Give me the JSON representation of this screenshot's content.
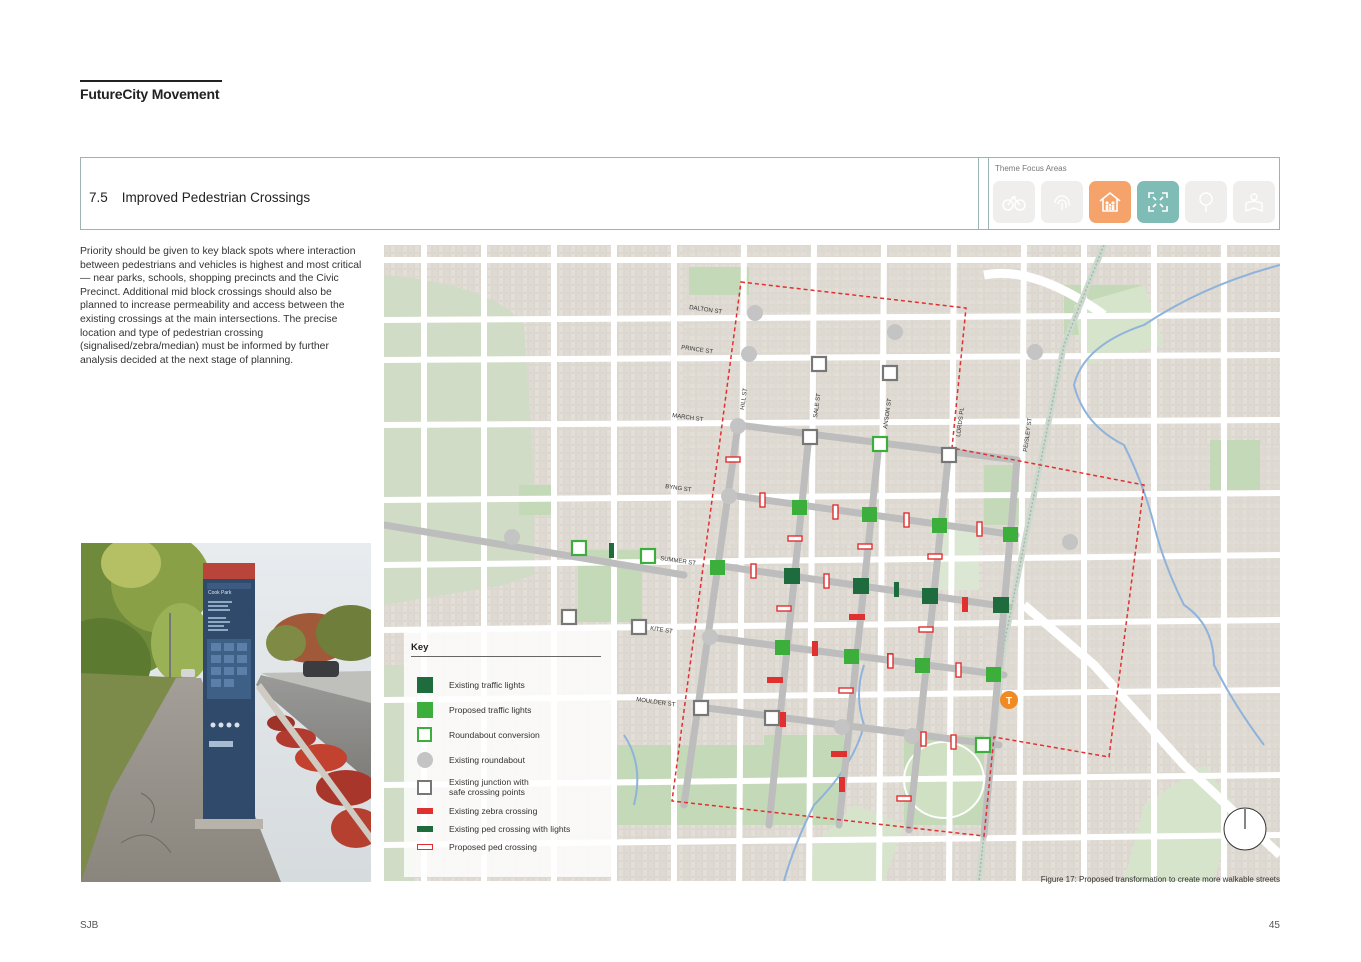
{
  "header": {
    "title": "FutureCity Movement"
  },
  "section": {
    "number": "7.5",
    "title": "Improved Pedestrian Crossings",
    "theme_label": "Theme Focus Areas",
    "themes": [
      {
        "icon": "bike-icon",
        "active": false
      },
      {
        "icon": "fingerprint-icon",
        "active": false
      },
      {
        "icon": "family-house-icon",
        "active": true,
        "color": "#f5a36b"
      },
      {
        "icon": "expand-icon",
        "active": true,
        "color": "#7fbcb5"
      },
      {
        "icon": "tree-icon",
        "active": false
      },
      {
        "icon": "reading-person-icon",
        "active": false
      }
    ]
  },
  "intro": "Priority should be given to key black spots where interaction between pedestrians and vehicles is highest and most critical — near parks, schools, shopping precincts and the Civic Precinct. Additional mid block crossings should also be planned to increase permeability and access between the existing crossings at the main intersections. The precise location and type of pedestrian crossing (signalised/zebra/median) must be informed by further analysis decided at the next stage of planning.",
  "photo": {
    "sign_title": "Cook Park"
  },
  "map": {
    "street_labels": [
      "DALTON ST",
      "PRINCE ST",
      "MARCH ST",
      "BYNG ST",
      "SUMMER ST",
      "KITE ST",
      "MOULDER ST",
      "HILL ST",
      "SALE ST",
      "ANSON ST",
      "LORDS PL",
      "PEISLEY ST"
    ],
    "station_marker": "T",
    "colors": {
      "existing_lights": "#1e6b3e",
      "proposed_lights": "#3cae3c",
      "roundabout": "#c4c4c4",
      "zebra": "#e03030",
      "boundary": "#e03030"
    }
  },
  "key": {
    "title": "Key",
    "items": [
      {
        "label": "Existing traffic lights",
        "symbol": "dark-green-square"
      },
      {
        "label": "Proposed traffic lights",
        "symbol": "green-square"
      },
      {
        "label": "Roundabout conversion",
        "symbol": "green-outline-square"
      },
      {
        "label": "Existing roundabout",
        "symbol": "grey-circle"
      },
      {
        "label": "Existing junction with",
        "label2": "safe crossing points",
        "symbol": "grey-outline-square"
      },
      {
        "label": "Existing zebra crossing",
        "symbol": "red-bar"
      },
      {
        "label": "Existing ped crossing with lights",
        "symbol": "dark-green-bar"
      },
      {
        "label": "Proposed ped crossing",
        "symbol": "red-outline-bar"
      }
    ]
  },
  "caption": "Figure 17: Proposed transformation to create more walkable streets",
  "footer": {
    "left": "SJB",
    "page": "45"
  }
}
